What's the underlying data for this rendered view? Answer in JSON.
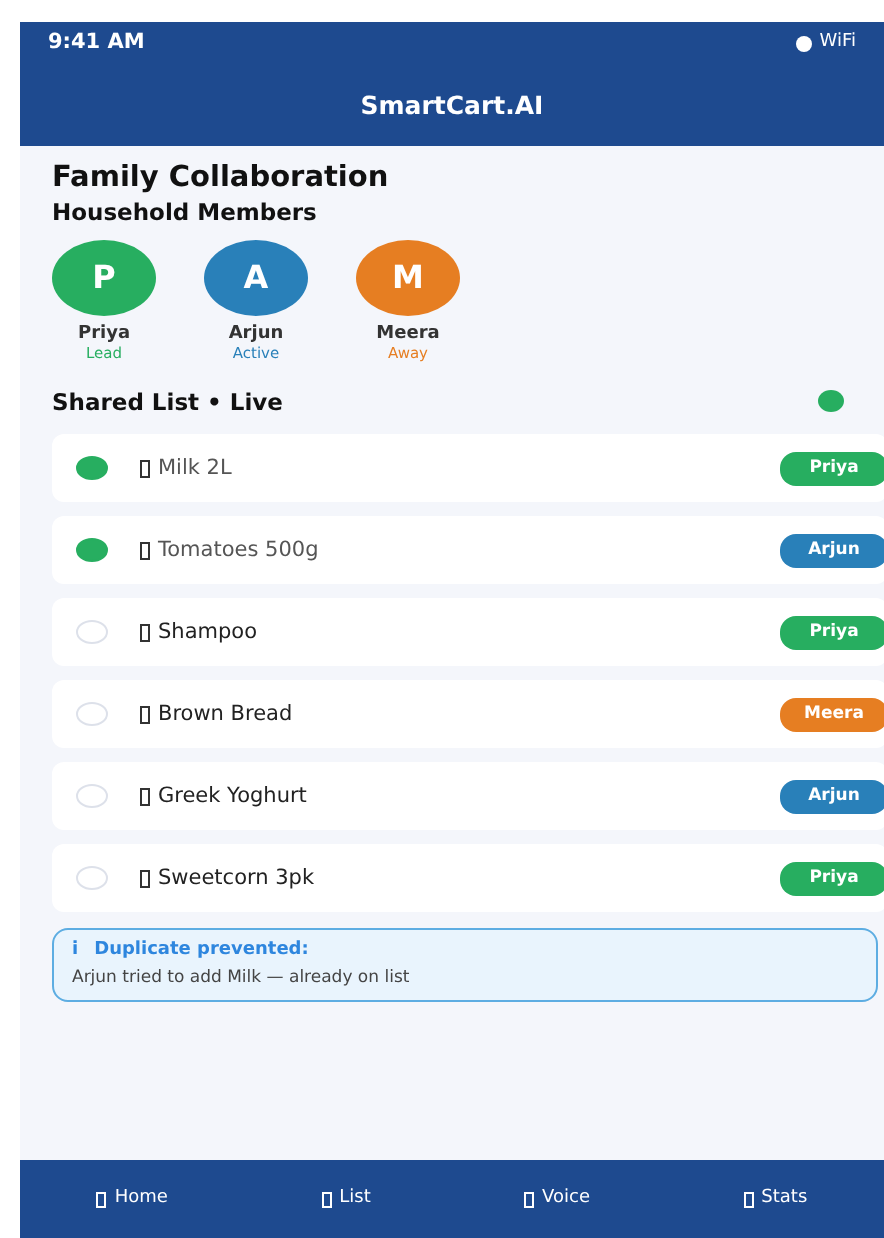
{
  "status_bar": {
    "time": "9:41 AM",
    "network": "WiFi"
  },
  "app_title": "SmartCart.AI",
  "page_title": "Family Collaboration",
  "members_heading": "Household Members",
  "members": [
    {
      "initial": "P",
      "name": "Priya",
      "status": "Lead",
      "color": "#27ae60"
    },
    {
      "initial": "A",
      "name": "Arjun",
      "status": "Active",
      "color": "#2980b9"
    },
    {
      "initial": "M",
      "name": "Meera",
      "status": "Away",
      "color": "#e67e22"
    }
  ],
  "shared_list": {
    "title": "Shared List  •  Live",
    "live": true,
    "items": [
      {
        "name": "Milk 2L",
        "checked": true,
        "owner": "Priya",
        "color": "#27ae60"
      },
      {
        "name": "Tomatoes 500g",
        "checked": true,
        "owner": "Arjun",
        "color": "#2980b9"
      },
      {
        "name": "Shampoo",
        "checked": false,
        "owner": "Priya",
        "color": "#27ae60"
      },
      {
        "name": "Brown Bread",
        "checked": false,
        "owner": "Meera",
        "color": "#e67e22"
      },
      {
        "name": "Greek Yoghurt",
        "checked": false,
        "owner": "Arjun",
        "color": "#2980b9"
      },
      {
        "name": "Sweetcorn 3pk",
        "checked": false,
        "owner": "Priya",
        "color": "#27ae60"
      }
    ]
  },
  "alert": {
    "icon": "i",
    "title": "Duplicate prevented:",
    "message": "Arjun tried to add Milk — already on list"
  },
  "tabs": [
    {
      "label": "Home"
    },
    {
      "label": "List"
    },
    {
      "label": "Voice"
    },
    {
      "label": "Stats"
    }
  ]
}
